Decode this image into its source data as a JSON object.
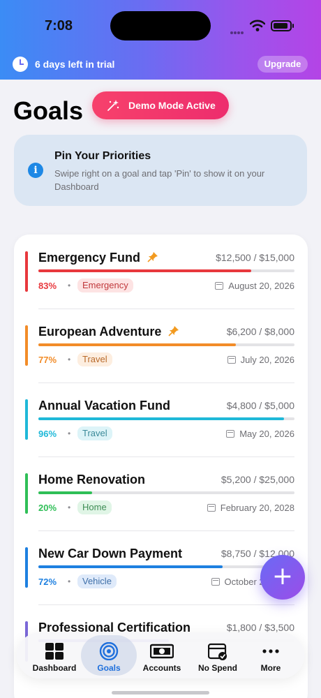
{
  "status_bar": {
    "time": "7:08"
  },
  "trial_banner": {
    "text": "6 days left in trial",
    "upgrade_label": "Upgrade",
    "icon": "clock-icon"
  },
  "page": {
    "title": "Goals"
  },
  "demo_mode": {
    "label": "Demo Mode Active",
    "icon": "magic-wand-icon"
  },
  "hint": {
    "title": "Pin Your Priorities",
    "body": "Swipe right on a goal and tap 'Pin' to show it on your Dashboard",
    "icon": "info-icon"
  },
  "goals": [
    {
      "name": "Emergency Fund",
      "pinned": true,
      "amount": "$12,500 / $15,000",
      "percent": "83%",
      "progress": 0.83,
      "category": "Emergency",
      "date": "August 20, 2026",
      "color": "#e8383d",
      "tag_bg": "#fde3e3",
      "tag_fg": "#c0393c"
    },
    {
      "name": "European Adventure",
      "pinned": true,
      "amount": "$6,200 / $8,000",
      "percent": "77%",
      "progress": 0.77,
      "category": "Travel",
      "date": "July 20, 2026",
      "color": "#f28c28",
      "tag_bg": "#fdeee0",
      "tag_fg": "#b96a2a"
    },
    {
      "name": "Annual Vacation Fund",
      "pinned": false,
      "amount": "$4,800 / $5,000",
      "percent": "96%",
      "progress": 0.96,
      "category": "Travel",
      "date": "May 20, 2026",
      "color": "#1fb8d8",
      "tag_bg": "#ddf4f8",
      "tag_fg": "#3b8a99"
    },
    {
      "name": "Home Renovation",
      "pinned": false,
      "amount": "$5,200 / $25,000",
      "percent": "20%",
      "progress": 0.21,
      "category": "Home",
      "date": "February 20, 2028",
      "color": "#2fbf57",
      "tag_bg": "#e0f5e6",
      "tag_fg": "#3e8d55"
    },
    {
      "name": "New Car Down Payment",
      "pinned": false,
      "amount": "$8,750 / $12,000",
      "percent": "72%",
      "progress": 0.72,
      "category": "Vehicle",
      "date": "October 20, 2026",
      "color": "#1e80e0",
      "tag_bg": "#dfeafa",
      "tag_fg": "#3e6fa8"
    },
    {
      "name": "Professional Certification",
      "pinned": false,
      "amount": "$1,800 / $3,500",
      "percent": "",
      "progress": 0.51,
      "category": "",
      "date": "",
      "color": "#7b68d8",
      "tag_bg": "#ece8fb",
      "tag_fg": "#6a55c0"
    }
  ],
  "fab": {
    "label": "+",
    "icon": "plus-icon"
  },
  "tab_bar": {
    "items": [
      {
        "label": "Dashboard",
        "icon": "grid-icon",
        "active": false
      },
      {
        "label": "Goals",
        "icon": "target-icon",
        "active": true
      },
      {
        "label": "Accounts",
        "icon": "banknote-icon",
        "active": false
      },
      {
        "label": "No Spend",
        "icon": "calendar-check-icon",
        "active": false
      },
      {
        "label": "More",
        "icon": "ellipsis-icon",
        "active": false
      }
    ]
  }
}
